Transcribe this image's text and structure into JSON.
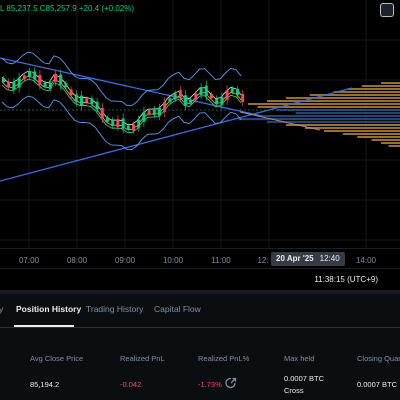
{
  "chart": {
    "ohlc_text": "L 85,237.5  C85,257.9  +20.4 (+0.02%)",
    "colors": {
      "up": "#0ecb81",
      "down": "#f6465d",
      "trendline": "#3d6be0",
      "band": "#5b9bf0",
      "ma_yellow": "#f0c20f",
      "ma_white": "#e6e6e6",
      "ma_green": "#38d79f",
      "volume_profile": "#c8963c",
      "volume_profile_blue": "#2f5a9c"
    }
  },
  "time_axis": {
    "ticks": [
      "07:00",
      "08:00",
      "09:00",
      "10:00",
      "11:00",
      "12:",
      "14:00"
    ],
    "cursor_date": "20 Apr '25",
    "cursor_time": "12:40"
  },
  "footer": {
    "clock": "11:38:15 (UTC+9)"
  },
  "panel": {
    "tabs": [
      {
        "label": "y"
      },
      {
        "label": "Position History"
      },
      {
        "label": "Trading History"
      },
      {
        "label": "Capital Flow"
      }
    ],
    "columns": [
      "Avg Close Price",
      "Realized PnL",
      "Realized PnL%",
      "Max held",
      "Closing Quant"
    ],
    "row": {
      "avg_close_price": "85,194.2",
      "realized_pnl": "-0.042",
      "realized_pnl_pct": "-1.73%",
      "max_held": "0.0007 BTC",
      "max_held_mode": "Cross",
      "closing_quantity": "0.0007 BTC"
    }
  }
}
